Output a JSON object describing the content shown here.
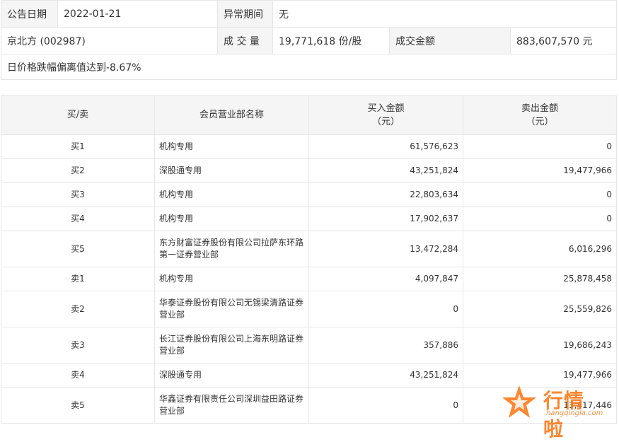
{
  "info": {
    "announce_date_label": "公告日期",
    "announce_date": "2022-01-21",
    "abnormal_period_label": "异常期间",
    "abnormal_period": "无",
    "stock": "京北方 (002987)",
    "volume_label": "成 交 量",
    "volume": "19,771,618 份/股",
    "turnover_label": "成交金额",
    "turnover": "883,607,570 元",
    "deviation": "日价格跌幅偏离值达到-8.67%"
  },
  "trade_table": {
    "headers": {
      "side": "买/卖",
      "broker": "会员营业部名称",
      "buy_line1": "买入金额",
      "buy_line2": "（元）",
      "sell_line1": "卖出金额",
      "sell_line2": "（元）"
    },
    "rows": [
      {
        "side": "买1",
        "broker": "机构专用",
        "buy": "61,576,623",
        "sell": "0"
      },
      {
        "side": "买2",
        "broker": "深股通专用",
        "buy": "43,251,824",
        "sell": "19,477,966"
      },
      {
        "side": "买3",
        "broker": "机构专用",
        "buy": "22,803,634",
        "sell": "0"
      },
      {
        "side": "买4",
        "broker": "机构专用",
        "buy": "17,902,637",
        "sell": "0"
      },
      {
        "side": "买5",
        "broker": "东方财富证券股份有限公司拉萨东环路第一证券营业部",
        "buy": "13,472,284",
        "sell": "6,016,296"
      },
      {
        "side": "卖1",
        "broker": "机构专用",
        "buy": "4,097,847",
        "sell": "25,878,458"
      },
      {
        "side": "卖2",
        "broker": "华泰证券股份有限公司无锡梁清路证券营业部",
        "buy": "0",
        "sell": "25,559,826"
      },
      {
        "side": "卖3",
        "broker": "长江证券股份有限公司上海东明路证券营业部",
        "buy": "357,886",
        "sell": "19,686,243"
      },
      {
        "side": "卖4",
        "broker": "深股通专用",
        "buy": "43,251,824",
        "sell": "19,477,966"
      },
      {
        "side": "卖5",
        "broker": "华鑫证券有限责任公司深圳益田路证券营业部",
        "buy": "0",
        "sell": "13,417,446"
      }
    ]
  },
  "watermark": {
    "text": "行情啦",
    "domain": "hangqingla.com",
    "icon": "star-logo-icon",
    "color": "#ff7a1a"
  }
}
